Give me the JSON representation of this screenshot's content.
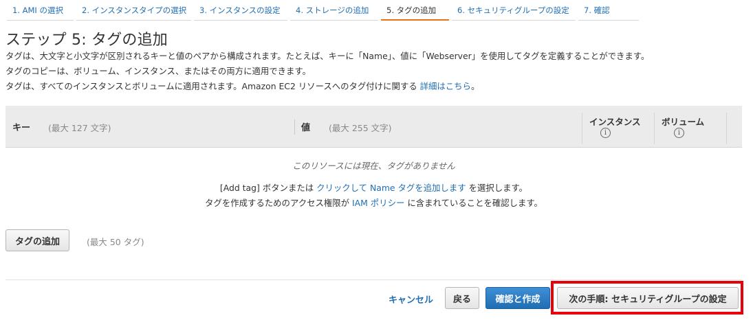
{
  "steps": [
    {
      "label": "1. AMI の選択"
    },
    {
      "label": "2. インスタンスタイプの選択"
    },
    {
      "label": "3. インスタンスの設定"
    },
    {
      "label": "4. ストレージの追加"
    },
    {
      "label": "5. タグの追加"
    },
    {
      "label": "6. セキュリティグループの設定"
    },
    {
      "label": "7. 確認"
    }
  ],
  "active_step": 5,
  "page_title": "ステップ 5: タグの追加",
  "description": {
    "line1": "タグは、大文字と小文字が区別されるキーと値のペアから構成されます。たとえば、キーに「Name」、値に「Webserver」を使用してタグを定義することができます。",
    "line2": "タグのコピーは、ボリューム、インスタンス、またはその両方に適用できます。",
    "line3": "タグは、すべてのインスタンスとボリュームに適用されます。Amazon EC2 リソースへのタグ付けに関する",
    "line3_link": "詳細はこちら",
    "line3_end": "。"
  },
  "table": {
    "key_header": "キー",
    "key_hint": "(最大 127 文字)",
    "value_header": "値",
    "value_hint": "(最大 255 文字)",
    "instances_header": "インスタンス",
    "volumes_header": "ボリューム",
    "info_glyph": "i",
    "empty_message": "このリソースには現在、タグがありません"
  },
  "help": {
    "line1_pre": "[Add tag] ボタンまたは",
    "line1_link": "クリックして Name タグを追加します",
    "line1_post": "を選択します。",
    "line2_pre": "タグを作成するためのアクセス権限が",
    "line2_link": "IAM ポリシー",
    "line2_post": "に含まれていることを確認します。"
  },
  "add_tag": {
    "button_label": "タグの追加",
    "hint": "(最大 50 タグ)"
  },
  "footer": {
    "cancel_label": "キャンセル",
    "back_label": "戻る",
    "review_label": "確認と作成",
    "next_label": "次の手順: セキュリティグループの設定"
  },
  "colors": {
    "link": "#1f6eb4",
    "active_tab_underline": "#ec7211",
    "primary_button": "#1f6eb4",
    "highlight_box": "#e8000b"
  }
}
